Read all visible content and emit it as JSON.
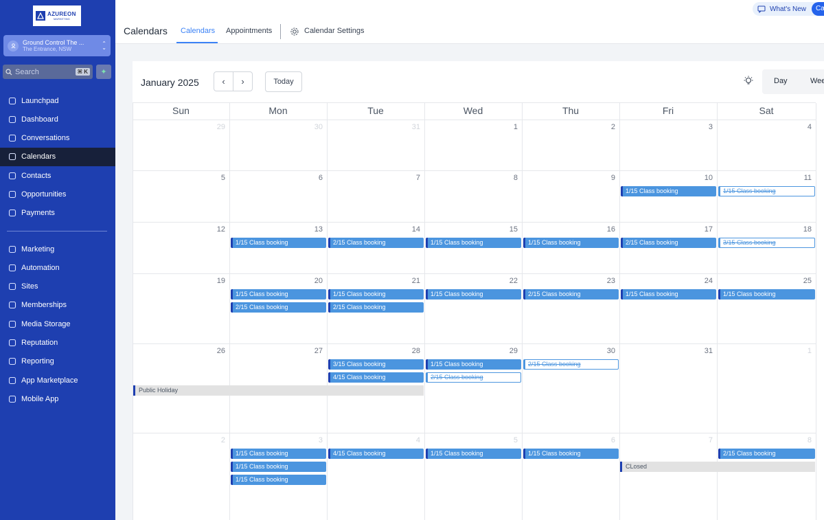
{
  "brand": {
    "name": "AZUREON",
    "sub": "MARKETING"
  },
  "location": {
    "name": "Ground Control The ...",
    "address": "The Entrance, NSW"
  },
  "search": {
    "placeholder": "Search",
    "shortcut": "⌘ K"
  },
  "nav": [
    {
      "label": "Launchpad",
      "icon": "rocket-icon"
    },
    {
      "label": "Dashboard",
      "icon": "grid-icon"
    },
    {
      "label": "Conversations",
      "icon": "chat-icon"
    },
    {
      "label": "Calendars",
      "icon": "calendar-icon",
      "active": true
    },
    {
      "label": "Contacts",
      "icon": "contacts-icon"
    },
    {
      "label": "Opportunities",
      "icon": "opportunities-icon"
    },
    {
      "label": "Payments",
      "icon": "payments-icon"
    }
  ],
  "nav2": [
    {
      "label": "Marketing",
      "icon": "send-icon"
    },
    {
      "label": "Automation",
      "icon": "automation-icon"
    },
    {
      "label": "Sites",
      "icon": "sites-icon"
    },
    {
      "label": "Memberships",
      "icon": "badge-icon"
    },
    {
      "label": "Media Storage",
      "icon": "image-icon"
    },
    {
      "label": "Reputation",
      "icon": "star-icon"
    },
    {
      "label": "Reporting",
      "icon": "trend-icon"
    },
    {
      "label": "App Marketplace",
      "icon": "apps-icon"
    },
    {
      "label": "Mobile App",
      "icon": "mobile-icon"
    }
  ],
  "header": {
    "title": "Calendars",
    "tabs": [
      "Calendars",
      "Appointments",
      "Calendar Settings"
    ],
    "whats_new": "What's New",
    "cta": "Ca"
  },
  "calendar": {
    "month": "January 2025",
    "today": "Today",
    "views": [
      "Day",
      "Wee"
    ],
    "days_of_week": [
      "Sun",
      "Mon",
      "Tue",
      "Wed",
      "Thu",
      "Fri",
      "Sat"
    ],
    "weeks": [
      [
        29,
        30,
        31,
        1,
        2,
        3,
        4
      ],
      [
        5,
        6,
        7,
        8,
        9,
        10,
        11
      ],
      [
        12,
        13,
        14,
        15,
        16,
        17,
        18
      ],
      [
        19,
        20,
        21,
        22,
        23,
        24,
        25
      ],
      [
        26,
        27,
        28,
        29,
        30,
        31,
        1
      ],
      [
        2,
        3,
        4,
        5,
        6,
        7,
        8
      ]
    ],
    "events": [
      {
        "week": 1,
        "day": 5,
        "slot": 0,
        "label": "1/15  Class booking"
      },
      {
        "week": 1,
        "day": 6,
        "slot": 0,
        "label": "1/15  Class booking",
        "cancelled": true
      },
      {
        "week": 2,
        "day": 1,
        "slot": 0,
        "label": "1/15  Class booking"
      },
      {
        "week": 2,
        "day": 2,
        "slot": 0,
        "label": "2/15  Class booking"
      },
      {
        "week": 2,
        "day": 3,
        "slot": 0,
        "label": "1/15  Class booking"
      },
      {
        "week": 2,
        "day": 4,
        "slot": 0,
        "label": "1/15  Class booking"
      },
      {
        "week": 2,
        "day": 5,
        "slot": 0,
        "label": "2/15  Class booking"
      },
      {
        "week": 2,
        "day": 6,
        "slot": 0,
        "label": "3/15  Class booking",
        "cancelled": true
      },
      {
        "week": 3,
        "day": 1,
        "slot": 0,
        "label": "1/15  Class booking"
      },
      {
        "week": 3,
        "day": 1,
        "slot": 1,
        "label": "2/15  Class booking"
      },
      {
        "week": 3,
        "day": 2,
        "slot": 0,
        "label": "1/15  Class booking"
      },
      {
        "week": 3,
        "day": 2,
        "slot": 1,
        "label": "2/15  Class booking"
      },
      {
        "week": 3,
        "day": 3,
        "slot": 0,
        "label": "1/15  Class booking"
      },
      {
        "week": 3,
        "day": 4,
        "slot": 0,
        "label": "2/15  Class booking"
      },
      {
        "week": 3,
        "day": 5,
        "slot": 0,
        "label": "1/15  Class booking"
      },
      {
        "week": 3,
        "day": 6,
        "slot": 0,
        "label": "1/15  Class booking"
      },
      {
        "week": 4,
        "day": 2,
        "slot": 0,
        "label": "3/15  Class booking"
      },
      {
        "week": 4,
        "day": 2,
        "slot": 1,
        "label": "4/15  Class booking"
      },
      {
        "week": 4,
        "day": 3,
        "slot": 0,
        "label": "1/15  Class booking"
      },
      {
        "week": 4,
        "day": 3,
        "slot": 1,
        "label": "2/15  Class booking",
        "cancelled": true
      },
      {
        "week": 4,
        "day": 4,
        "slot": 0,
        "label": "2/15  Class booking",
        "cancelled": true
      },
      {
        "week": 5,
        "day": 1,
        "slot": 0,
        "label": "1/15  Class booking"
      },
      {
        "week": 5,
        "day": 1,
        "slot": 1,
        "label": "1/15  Class booking"
      },
      {
        "week": 5,
        "day": 1,
        "slot": 2,
        "label": "1/15  Class booking"
      },
      {
        "week": 5,
        "day": 2,
        "slot": 0,
        "label": "4/15  Class booking"
      },
      {
        "week": 5,
        "day": 3,
        "slot": 0,
        "label": "1/15  Class booking"
      },
      {
        "week": 5,
        "day": 4,
        "slot": 0,
        "label": "1/15  Class booking"
      },
      {
        "week": 5,
        "day": 6,
        "slot": 0,
        "label": "2/15  Class booking"
      }
    ],
    "all_day": [
      {
        "week": 4,
        "start": 0,
        "end": 2,
        "slot": 2,
        "label": "Public Holiday"
      },
      {
        "week": 5,
        "start": 5,
        "end": 6,
        "slot": 1,
        "label": "CLosed"
      }
    ]
  }
}
